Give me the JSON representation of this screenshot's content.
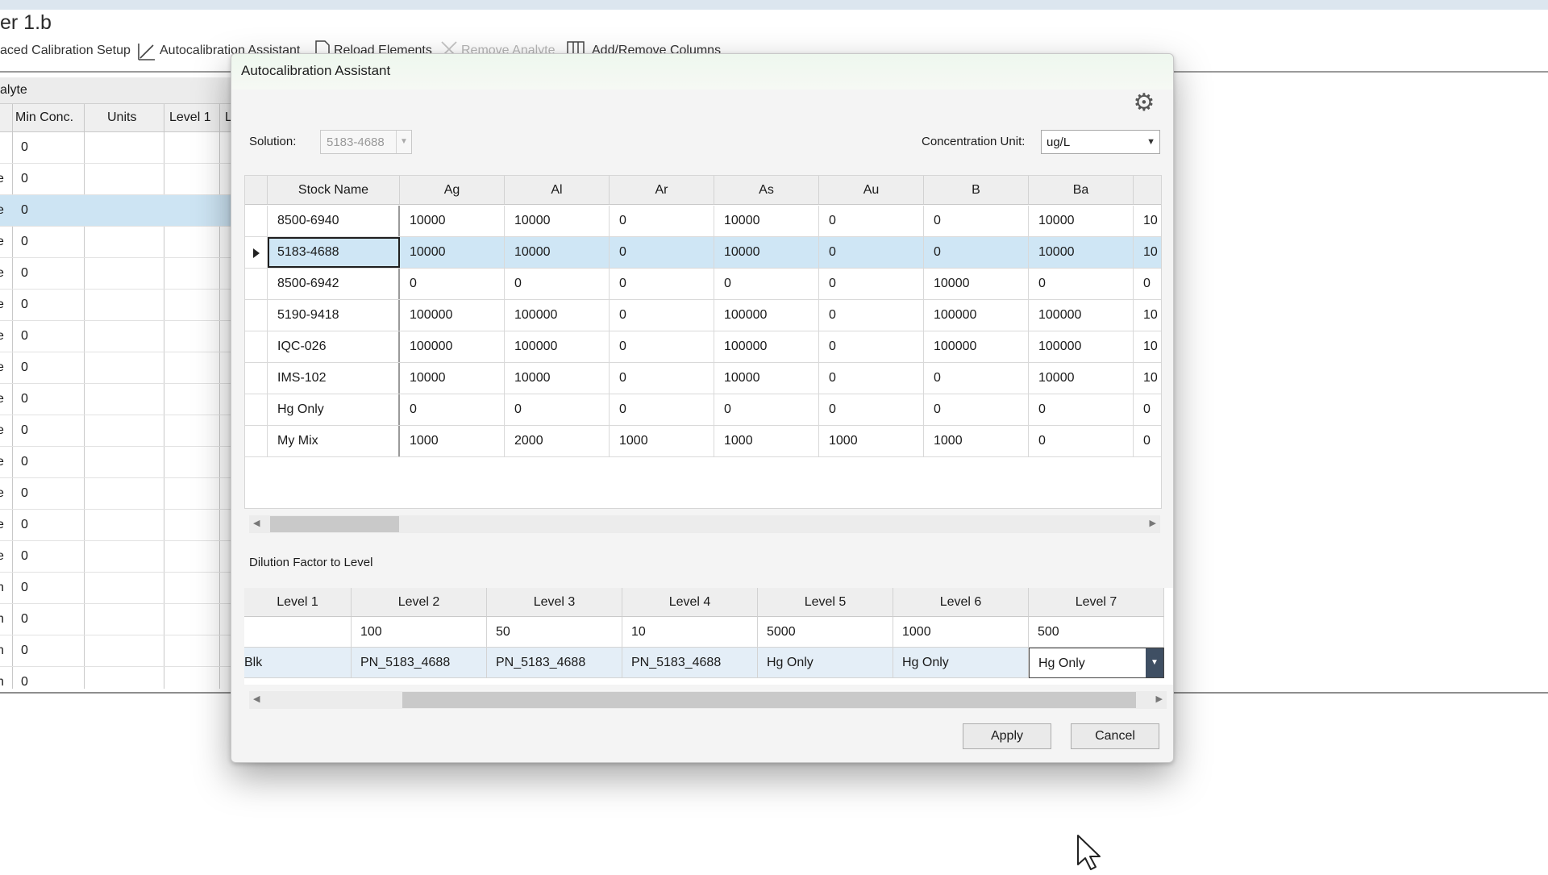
{
  "background": {
    "title": "er 1.b",
    "toolbar": {
      "advanced_setup": "aced Calibration Setup",
      "autocal": "Autocalibration Assistant",
      "reload": "Reload Elements",
      "remove": "Remove Analyte",
      "add_remove_columns": "Add/Remove Columns"
    },
    "grid": {
      "group_label": "alyte",
      "headers": [
        "Min Conc.",
        "Units",
        "Level 1",
        "L"
      ],
      "rows": [
        {
          "c0": ":",
          "c1": "0"
        },
        {
          "c0": "e",
          "c1": "0"
        },
        {
          "c0": "e",
          "c1": "0"
        },
        {
          "c0": "e",
          "c1": "0"
        },
        {
          "c0": "e",
          "c1": "0"
        },
        {
          "c0": "e",
          "c1": "0"
        },
        {
          "c0": "e",
          "c1": "0"
        },
        {
          "c0": "e",
          "c1": "0"
        },
        {
          "c0": "e",
          "c1": "0"
        },
        {
          "c0": "e",
          "c1": "0"
        },
        {
          "c0": "e",
          "c1": "0"
        },
        {
          "c0": "e",
          "c1": "0"
        },
        {
          "c0": "e",
          "c1": "0"
        },
        {
          "c0": "e",
          "c1": "0"
        },
        {
          "c0": "n",
          "c1": "0"
        },
        {
          "c0": "n",
          "c1": "0"
        },
        {
          "c0": "n",
          "c1": "0"
        },
        {
          "c0": "n",
          "c1": "0"
        }
      ]
    }
  },
  "dialog": {
    "title": "Autocalibration Assistant",
    "solution_label": "Solution:",
    "solution_value": "5183-4688",
    "conc_label": "Concentration Unit:",
    "conc_value": "ug/L",
    "stock_grid": {
      "headers": [
        "Stock Name",
        "Ag",
        "Al",
        "Ar",
        "As",
        "Au",
        "B",
        "Ba",
        ""
      ],
      "rows": [
        [
          "8500-6940",
          "10000",
          "10000",
          "0",
          "10000",
          "0",
          "0",
          "10000",
          "10"
        ],
        [
          "5183-4688",
          "10000",
          "10000",
          "0",
          "10000",
          "0",
          "0",
          "10000",
          "10"
        ],
        [
          "8500-6942",
          "0",
          "0",
          "0",
          "0",
          "0",
          "10000",
          "0",
          "0"
        ],
        [
          "5190-9418",
          "100000",
          "100000",
          "0",
          "100000",
          "0",
          "100000",
          "100000",
          "10"
        ],
        [
          "IQC-026",
          "100000",
          "100000",
          "0",
          "100000",
          "0",
          "100000",
          "100000",
          "10"
        ],
        [
          "IMS-102",
          "10000",
          "10000",
          "0",
          "10000",
          "0",
          "0",
          "10000",
          "10"
        ],
        [
          "Hg Only",
          "0",
          "0",
          "0",
          "0",
          "0",
          "0",
          "0",
          "0"
        ],
        [
          "My Mix",
          "1000",
          "2000",
          "1000",
          "1000",
          "1000",
          "1000",
          "0",
          "0"
        ]
      ]
    },
    "dilution_label": "Dilution Factor to Level",
    "dilution_grid": {
      "headers": [
        "Level 1",
        "Level 2",
        "Level 3",
        "Level 4",
        "Level 5",
        "Level 6",
        "Level 7"
      ],
      "factors": [
        "",
        "100",
        "50",
        "10",
        "5000",
        "1000",
        "500"
      ],
      "stocks": [
        "Blk",
        "PN_5183_4688",
        "PN_5183_4688",
        "PN_5183_4688",
        "Hg Only",
        "Hg Only",
        "Hg Only"
      ]
    },
    "apply_label": "Apply",
    "cancel_label": "Cancel"
  }
}
